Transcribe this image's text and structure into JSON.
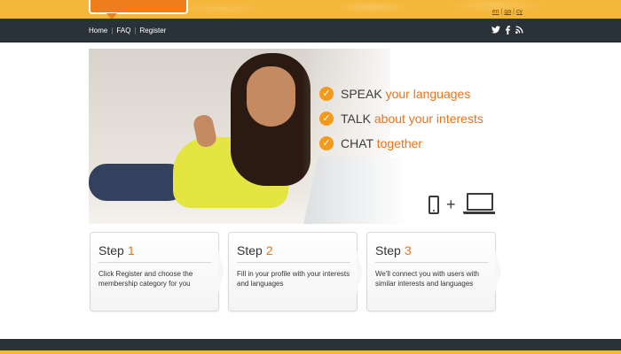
{
  "header": {
    "logo_alt": "",
    "languages": [
      "en",
      "ga",
      "cy"
    ]
  },
  "nav": {
    "links": [
      "Home",
      "FAQ",
      "Register"
    ],
    "social": [
      "twitter-icon",
      "facebook-icon",
      "rss-icon"
    ]
  },
  "hero": {
    "features": [
      {
        "verb": "SPEAK",
        "rest": "your languages"
      },
      {
        "verb": "TALK",
        "rest": "about your interests"
      },
      {
        "verb": "CHAT",
        "rest": "together"
      }
    ],
    "devices": [
      "phone-icon",
      "laptop-icon"
    ],
    "plus": "+"
  },
  "steps": [
    {
      "label": "Step",
      "number": "1",
      "description": "Click Register and choose the membership category for you"
    },
    {
      "label": "Step",
      "number": "2",
      "description": "Fill in your profile with your interests and languages"
    },
    {
      "label": "Step",
      "number": "3",
      "description": "We'll connect you with users with similar interests and languages"
    }
  ],
  "colors": {
    "banner_orange": "#f5b73a",
    "nav_dark": "#283238",
    "accent_orange": "#e8741a",
    "check_orange": "#f39a1c"
  }
}
